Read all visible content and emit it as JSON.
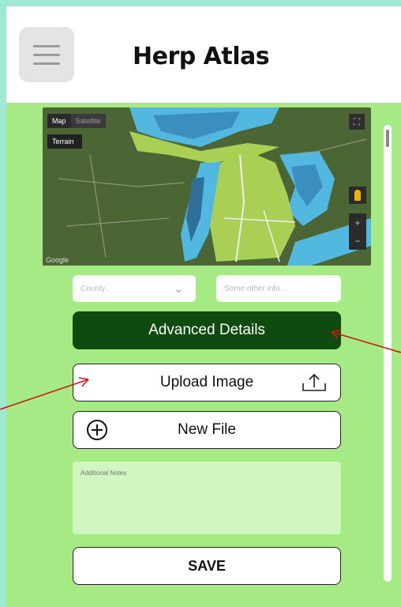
{
  "app": {
    "title": "Herp Atlas"
  },
  "header": {
    "menu_icon": "hamburger-menu-icon"
  },
  "map": {
    "map_tab": "Map",
    "satellite_tab": "Satellite",
    "terrain_toggle": "Terrain",
    "google_logo": "Google",
    "fullscreen_icon": "fullscreen-icon",
    "pegman_icon": "pegman-icon",
    "zoom_in": "+",
    "zoom_out": "−"
  },
  "form": {
    "county_placeholder": "County..",
    "other_info_placeholder": "Some other info...",
    "advanced_details_label": "Advanced Details",
    "upload_image_label": "Upload Image",
    "new_file_label": "New File",
    "notes_placeholder": "Additional Notes",
    "save_label": "SAVE"
  },
  "colors": {
    "background": "#a6ea86",
    "primary_button": "#0f4a0e",
    "annotation_arrow": "#d01818"
  }
}
